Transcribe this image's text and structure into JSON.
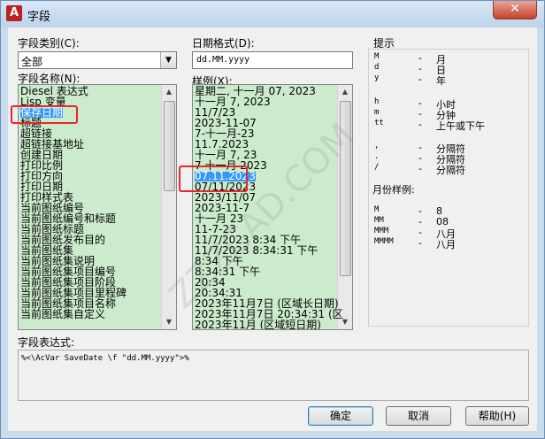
{
  "window": {
    "title": "字段",
    "close_glyph": "✕",
    "app_icon_letter": "A"
  },
  "category": {
    "label": "字段类别(C):",
    "value": "全部"
  },
  "field_names": {
    "label": "字段名称(N):",
    "items": [
      "Diesel 表达式",
      "Lisp 变量",
      "保存日期",
      "标题",
      "超链接",
      "超链接基地址",
      "创建日期",
      "打印比例",
      "打印方向",
      "打印日期",
      "打印样式表",
      "当前图纸编号",
      "当前图纸编号和标题",
      "当前图纸标题",
      "当前图纸发布目的",
      "当前图纸集",
      "当前图纸集说明",
      "当前图纸集项目编号",
      "当前图纸集项目阶段",
      "当前图纸集项目里程碑",
      "当前图纸集项目名称",
      "当前图纸集自定义"
    ],
    "selected_index": 2
  },
  "date_format": {
    "label": "日期格式(D):",
    "value": "dd.MM.yyyy"
  },
  "samples": {
    "label": "样例(X):",
    "items": [
      "星期二, 十一月 07, 2023",
      "十一月 7, 2023",
      "11/7/23",
      "2023-11-07",
      "7-十一月-23",
      "11.7.2023",
      "十一月 7, 23",
      "7 十一月 2023",
      "07.11.2023",
      "07/11/2023",
      "2023/11/07",
      "2023-11-7",
      "十一月 23",
      "11-7-23",
      "11/7/2023 8:34 下午",
      "11/7/2023 8:34:31 下午",
      "8:34 下午",
      "8:34:31 下午",
      "20:34",
      "20:34:31",
      "2023年11月7日 (区域长日期)",
      "2023年11月7日 20:34:31 (区",
      "2023年11月 (区域短日期)"
    ],
    "selected_index": 8
  },
  "hints": {
    "title": "提示",
    "rows": [
      {
        "code": "M",
        "sep": "-",
        "desc": "月"
      },
      {
        "code": "d",
        "sep": "-",
        "desc": "日"
      },
      {
        "code": "y",
        "sep": "-",
        "desc": "年"
      },
      {
        "code": "h",
        "sep": "-",
        "desc": "小时"
      },
      {
        "code": "m",
        "sep": "-",
        "desc": "分钟"
      },
      {
        "code": "tt",
        "sep": "-",
        "desc": "上午或下午"
      },
      {
        "code": ",",
        "sep": "-",
        "desc": "分隔符"
      },
      {
        "code": ".",
        "sep": "-",
        "desc": "分隔符"
      },
      {
        "code": "/",
        "sep": "-",
        "desc": "分隔符"
      }
    ],
    "month_title": "月份样例:",
    "month_rows": [
      {
        "code": "M",
        "sep": "-",
        "desc": "8"
      },
      {
        "code": "MM",
        "sep": "-",
        "desc": "08"
      },
      {
        "code": "MMM",
        "sep": "-",
        "desc": "八月"
      },
      {
        "code": "MMMM",
        "sep": "-",
        "desc": "八月"
      }
    ]
  },
  "expression": {
    "label": "字段表达式:",
    "value": "%<\\AcVar SaveDate \\f \"dd.MM.yyyy\">%"
  },
  "buttons": {
    "ok": "确定",
    "cancel": "取消",
    "help": "帮助(H)"
  },
  "watermark": "ZZZCAD.COM"
}
